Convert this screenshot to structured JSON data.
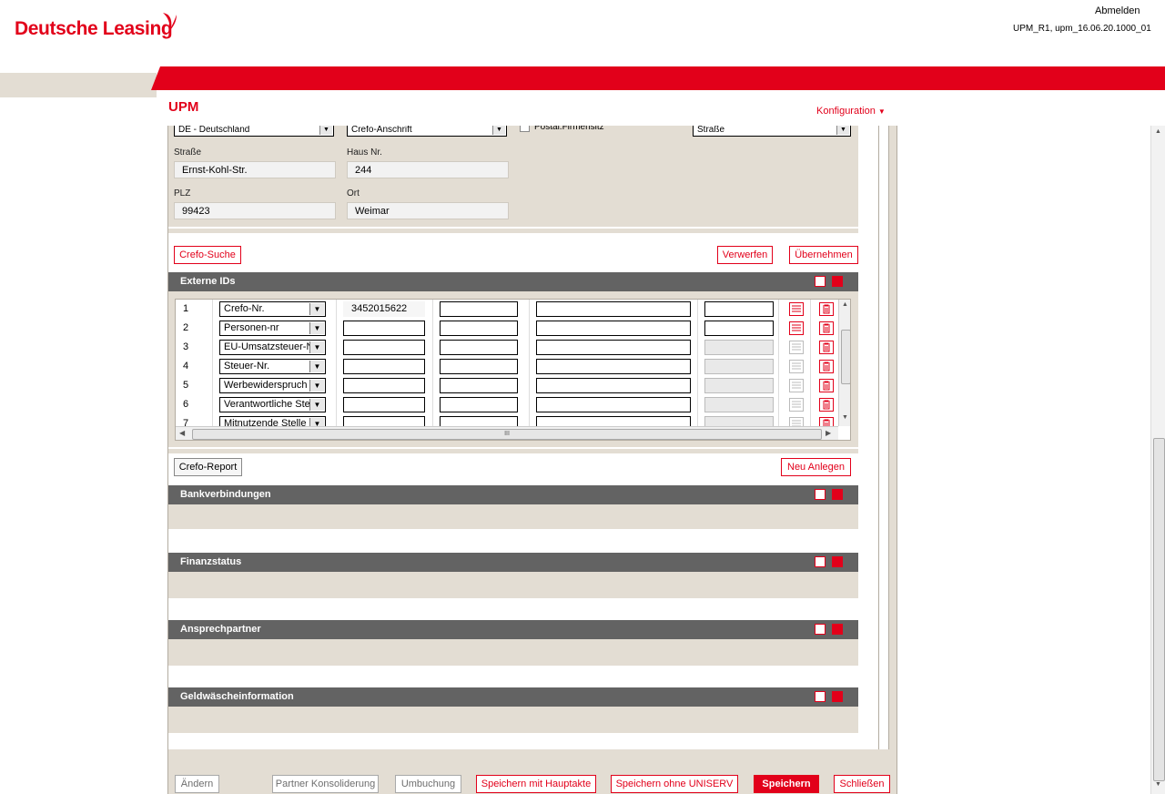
{
  "header": {
    "logo_text": "Deutsche Leasing",
    "abmelden": "Abmelden",
    "version": "UPM_R1, upm_16.06.20.1000_01",
    "app_title": "UPM",
    "konfiguration": "Konfiguration"
  },
  "address": {
    "country_select": "DE - Deutschland",
    "address_type_select": "Crefo-Anschrift",
    "postal_checkbox_label": "Postal.Firmensitz",
    "street_type_select": "Straße",
    "strasse_label": "Straße",
    "strasse_value": "Ernst-Kohl-Str.",
    "hausnr_label": "Haus Nr.",
    "hausnr_value": "244",
    "plz_label": "PLZ",
    "plz_value": "99423",
    "ort_label": "Ort",
    "ort_value": "Weimar"
  },
  "actions": {
    "crefo_suche": "Crefo-Suche",
    "verwerfen": "Verwerfen",
    "uebernehmen": "Übernehmen",
    "crefo_report": "Crefo-Report",
    "neu_anlegen": "Neu Anlegen"
  },
  "sections": {
    "externe_ids": "Externe IDs",
    "bankverbindungen": "Bankverbindungen",
    "finanzstatus": "Finanzstatus",
    "ansprechpartner": "Ansprechpartner",
    "geldwaesche": "Geldwäscheinformation"
  },
  "externe_ids_rows": [
    {
      "num": "1",
      "type": "Crefo-Nr.",
      "value": "3452015622"
    },
    {
      "num": "2",
      "type": "Personen-nr",
      "value": ""
    },
    {
      "num": "3",
      "type": "EU-Umsatzsteuer-N",
      "value": ""
    },
    {
      "num": "4",
      "type": "Steuer-Nr.",
      "value": ""
    },
    {
      "num": "5",
      "type": "Werbewiderspruch",
      "value": ""
    },
    {
      "num": "6",
      "type": "Verantwortliche Ste",
      "value": ""
    },
    {
      "num": "7",
      "type": "Mitnutzende Stelle",
      "value": ""
    }
  ],
  "scrollbar_grip": "III",
  "footer": {
    "aendern": "Ändern",
    "partner_konsolidierung": "Partner Konsoliderung",
    "umbuchung": "Umbuchung",
    "speichern_hauptakte": "Speichern mit Hauptakte",
    "speichern_ohne_uniserv": "Speichern ohne UNISERV",
    "speichern": "Speichern",
    "schliessen": "Schließen"
  },
  "colors": {
    "brand_red": "#e2001a",
    "section_grey": "#636363",
    "beige": "#e3ddd3"
  }
}
